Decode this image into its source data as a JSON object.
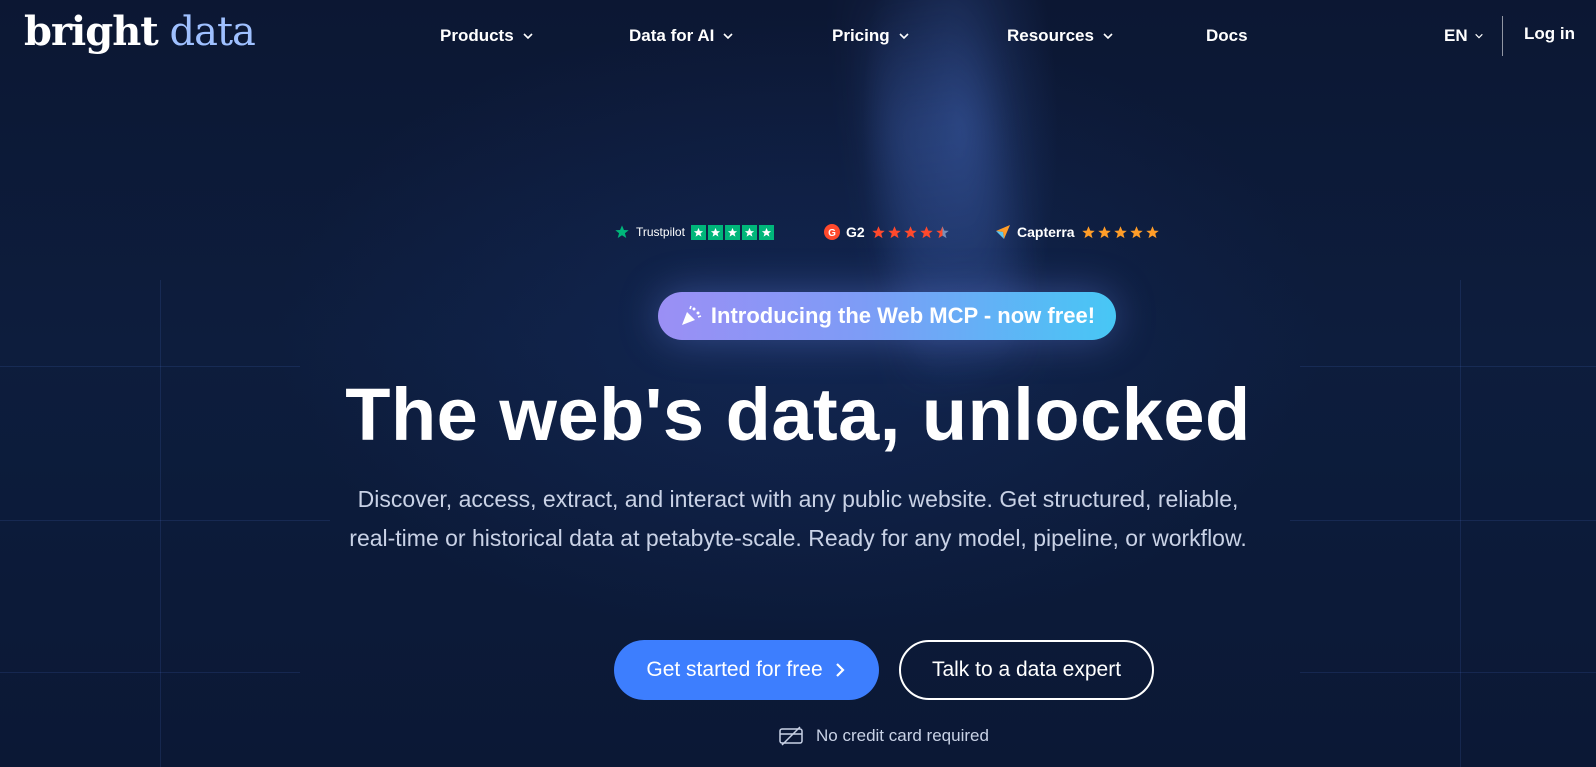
{
  "brand": {
    "word1": "bright",
    "word2": "data"
  },
  "nav": {
    "items": [
      {
        "label": "Products",
        "has_dropdown": true
      },
      {
        "label": "Data for AI",
        "has_dropdown": true
      },
      {
        "label": "Pricing",
        "has_dropdown": true
      },
      {
        "label": "Resources",
        "has_dropdown": true
      },
      {
        "label": "Docs",
        "has_dropdown": false
      }
    ],
    "language": "EN",
    "login": "Log in"
  },
  "ratings": {
    "trustpilot": {
      "label": "Trustpilot",
      "stars": 5,
      "color": "#00b67a",
      "icon": "trustpilot-star-icon"
    },
    "g2": {
      "label": "G2",
      "stars": 4.5,
      "color": "#ff492c",
      "icon": "g2-logo-icon"
    },
    "capterra": {
      "label": "Capterra",
      "stars": 5,
      "color": "#ff9d28",
      "icon": "capterra-logo-icon"
    }
  },
  "announcement": {
    "text": "Introducing the Web MCP - now free!",
    "icon": "party-popper-icon"
  },
  "hero": {
    "headline": "The web's data, unlocked",
    "subtext": "Discover, access, extract, and interact with any public website. Get structured, reliable, real-time or historical data at petabyte-scale. Ready for any model, pipeline, or workflow."
  },
  "cta": {
    "primary": "Get started for free",
    "secondary": "Talk to a data expert",
    "note": "No credit card required"
  },
  "colors": {
    "background": "#0b1834",
    "primary_button": "#3d7efe",
    "brand_accent": "#9fc0ff"
  }
}
